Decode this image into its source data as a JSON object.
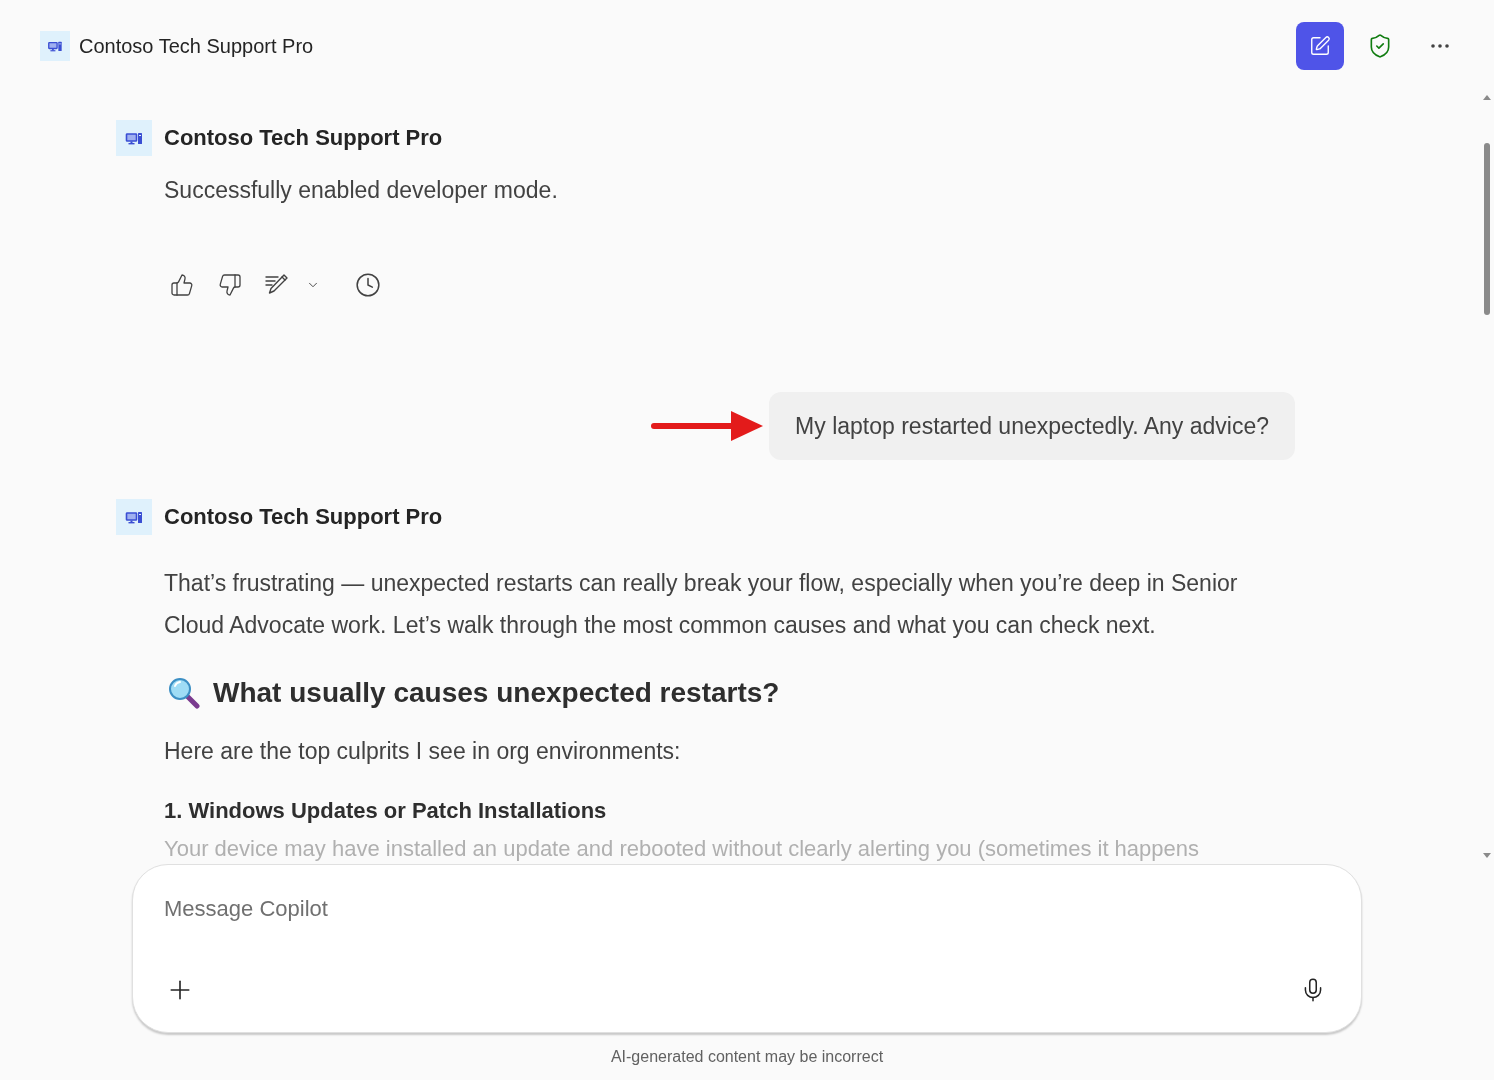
{
  "header": {
    "title": "Contoso Tech Support Pro"
  },
  "messages": [
    {
      "kind": "bot",
      "sender": "Contoso Tech Support Pro",
      "actions_shown": true,
      "blocks": [
        {
          "kind": "text",
          "text": "Successfully enabled developer mode."
        }
      ]
    },
    {
      "kind": "user",
      "pointer_arrow": true,
      "text": "My laptop restarted unexpectedly. Any advice?"
    },
    {
      "kind": "bot",
      "sender": "Contoso Tech Support Pro",
      "actions_shown": false,
      "blocks": [
        {
          "kind": "paragraph",
          "text": "That’s frustrating — unexpected restarts can really break your flow, especially when you’re deep in Senior Cloud Advocate work. Let’s walk through the most common causes and what you can check next."
        },
        {
          "kind": "heading",
          "text": "What usually causes unexpected restarts?"
        },
        {
          "kind": "paragraph",
          "text": "Here are the top culprits I see in org environments:"
        },
        {
          "kind": "subheading",
          "text": "1. Windows Updates or Patch Installations"
        },
        {
          "kind": "faded",
          "text": "Your device may have installed an update and rebooted without clearly alerting you (sometimes it happens"
        }
      ]
    }
  ],
  "composer": {
    "placeholder": "Message Copilot"
  },
  "disclaimer": "AI-generated content may be incorrect"
}
